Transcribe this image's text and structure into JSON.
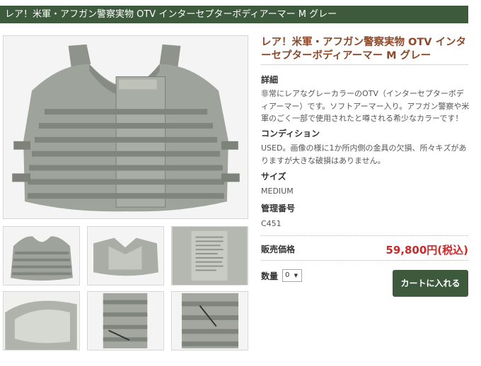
{
  "header": {
    "title": "レア！米軍・アフガン警察実物 OTV インターセプターボディアーマー M グレー"
  },
  "product": {
    "title": "レア！米軍・アフガン警察実物 OTV インターセプターボディアーマー M グレー",
    "sections": [
      {
        "heading": "詳細",
        "text": "非常にレアなグレーカラーのOTV（インターセプターボディアーマー）です。ソフトアーマー入り。アフガン警察や米軍のごく一部で使用されたと噂される希少なカラーです！"
      },
      {
        "heading": "コンディション",
        "text": "USED。画像の様に1か所内側の金具の欠損、所々キズがありますが大きな破損はありません。"
      },
      {
        "heading": "サイズ",
        "text": "MEDIUM"
      },
      {
        "heading": "管理番号",
        "text": "C451"
      }
    ],
    "price_label": "販売価格",
    "price": "59,800円(税込)",
    "quantity_label": "数量",
    "quantity_value": "0",
    "quantity_arrow": "▼",
    "cart_button": "カートに入れる"
  },
  "colors": {
    "header_bg": "#3e5a3d",
    "title_color": "#8b4a2b",
    "price_color": "#cc2929",
    "button_bg": "#3e5a3d"
  }
}
